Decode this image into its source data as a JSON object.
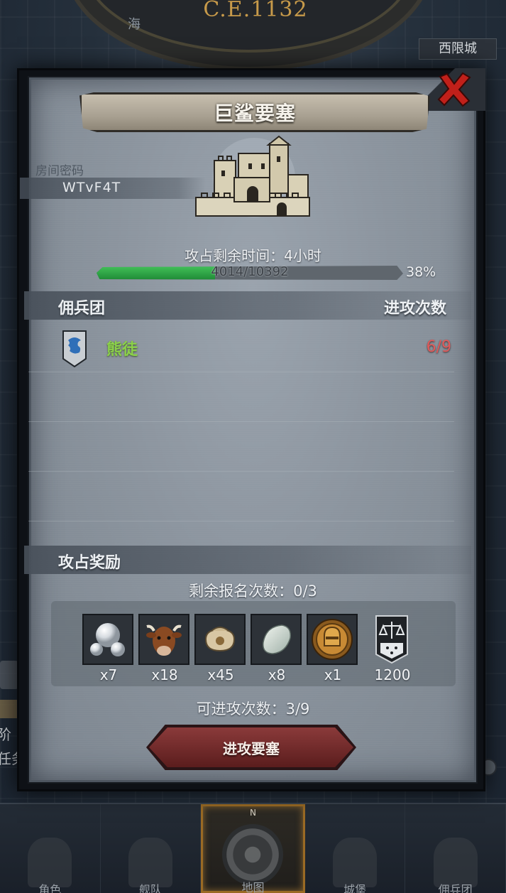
{
  "background": {
    "era": "C.E.1132",
    "sea_label": "海",
    "city_label": "西限城",
    "left_text_1": "阶",
    "left_text_2": "任务"
  },
  "bottom_nav": [
    {
      "label": "角色",
      "icon": "knight-icon"
    },
    {
      "label": "舰队",
      "icon": "fleet-icon"
    },
    {
      "label": "地图",
      "icon": "compass-icon",
      "active": true,
      "marker": "N"
    },
    {
      "label": "城堡",
      "icon": "castle-icon"
    },
    {
      "label": "佣兵团",
      "icon": "mercenary-icon"
    }
  ],
  "dialog": {
    "title": "巨鲨要塞",
    "room_label": "房间密码",
    "room_code": "WTvF4T",
    "time_text": "攻占剩余时间：4小时",
    "progress": {
      "current": 4014,
      "total": 10392,
      "text": "4014/10392",
      "percent_text": "38%",
      "fraction": 0.386
    },
    "mercenary_header": "佣兵团",
    "attacks_header": "进攻次数",
    "mercenaries": [
      {
        "name": "熊徒",
        "attacks": "6/9",
        "emblem_color": "#2f6fb8"
      }
    ],
    "reward_header": "攻占奖励",
    "signup_text": "剩余报名次数：0/3",
    "rewards": [
      {
        "icon": "pearl-icon",
        "qty": "x7"
      },
      {
        "icon": "cattle-icon",
        "qty": "x18"
      },
      {
        "icon": "grain-sack-icon",
        "qty": "x45"
      },
      {
        "icon": "gem-stone-icon",
        "qty": "x8"
      },
      {
        "icon": "knight-medal-icon",
        "qty": "x1"
      },
      {
        "icon": "justice-banner-icon",
        "qty": "1200"
      }
    ],
    "attack_count_text": "可进攻次数：3/9",
    "attack_button_label": "进攻要塞"
  },
  "colors": {
    "progress_green": "#2fae4a",
    "merc_name": "#8bd14a",
    "attack_count": "#e05a5a",
    "button_red": "#7a2e2e",
    "close_red": "#c0201a"
  }
}
